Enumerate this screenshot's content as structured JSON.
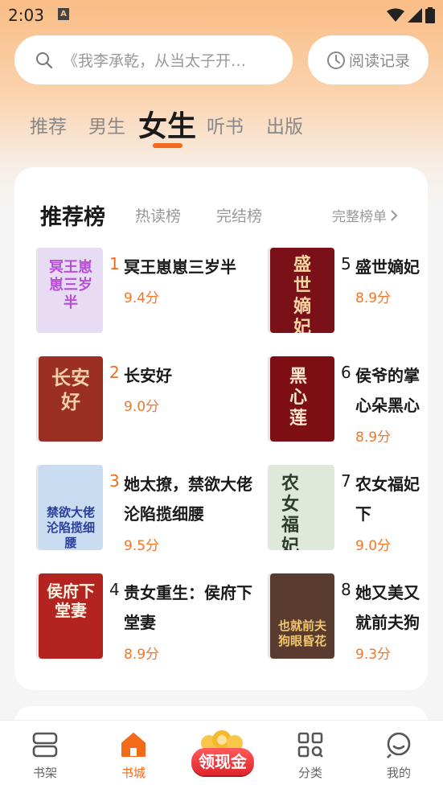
{
  "status_bar": {
    "time": "2:03",
    "notification_badge": "A"
  },
  "search": {
    "placeholder": "《我李承乾，从当太子开…",
    "history_label": "阅读记录"
  },
  "channels": {
    "tabs": [
      {
        "label": "推荐"
      },
      {
        "label": "男生"
      },
      {
        "label": "女生",
        "active": true
      },
      {
        "label": "听书"
      },
      {
        "label": "出版"
      }
    ]
  },
  "ranking": {
    "tabs": [
      {
        "label": "推荐榜",
        "active": true
      },
      {
        "label": "热读榜"
      },
      {
        "label": "完结榜"
      }
    ],
    "full_list_label": "完整榜单",
    "books": [
      {
        "rank": "1",
        "title": "冥王崽崽三岁半",
        "score": "9.4分",
        "cover_text": "冥王崽崽三岁半",
        "cover_color": "#e8dcf5"
      },
      {
        "rank": "2",
        "title": "长安好",
        "score": "9.0分",
        "cover_text": "长安好",
        "cover_color": "#9c2f24"
      },
      {
        "rank": "3",
        "title": "她太撩，禁欲大佬沦陷揽细腰",
        "score": "9.5分",
        "cover_text": "禁欲大佬沦陷揽细腰",
        "cover_color": "#c9dcf0"
      },
      {
        "rank": "4",
        "title": "贵女重生：侯府下堂妻",
        "score": "8.9分",
        "cover_text": "侯府下堂妻",
        "cover_color": "#b3231f"
      },
      {
        "rank": "5",
        "title": "盛世嫡妃",
        "score": "8.9分",
        "cover_text": "盛世嫡妃",
        "cover_color": "#7a1118"
      },
      {
        "rank": "6",
        "title": "侯爷的掌心朵黑心莲",
        "score": "8.9分",
        "cover_text": "黑心莲",
        "cover_color": "#7d0f14"
      },
      {
        "rank": "7",
        "title": "农女福妃下",
        "score": "9.0分",
        "cover_text": "农女福妃",
        "cover_color": "#dfe9da"
      },
      {
        "rank": "8",
        "title": "她又美又就前夫狗",
        "score": "9.3分",
        "cover_text": "也就前夫狗眼昏花",
        "cover_color": "#5a3b30"
      }
    ]
  },
  "bottom_nav": {
    "items": [
      {
        "label": "书架",
        "icon": "bookshelf-icon"
      },
      {
        "label": "书城",
        "icon": "store-icon",
        "active": true
      },
      {
        "label": "领现金",
        "icon": "coins-icon"
      },
      {
        "label": "分类",
        "icon": "category-icon"
      },
      {
        "label": "我的",
        "icon": "profile-icon"
      }
    ]
  },
  "colors": {
    "accent": "#f36a1b",
    "score": "#f0762b",
    "top_gradient": "#f9bd86"
  }
}
